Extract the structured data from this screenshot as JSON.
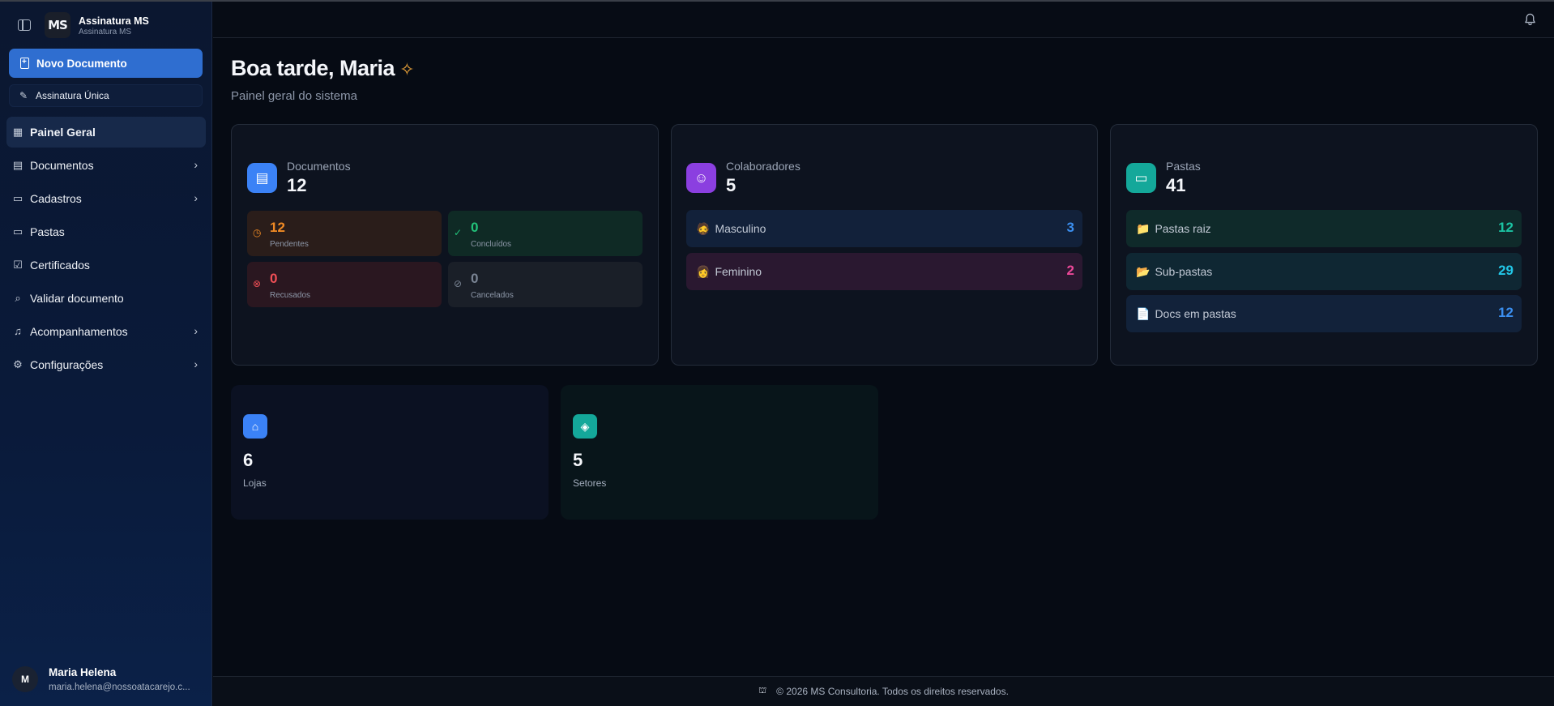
{
  "app": {
    "title": "Assinatura MS",
    "subtitle": "Assinatura MS",
    "logo_text": "MS"
  },
  "sidebar": {
    "new_document_label": "Novo Documento",
    "single_signature_label": "Assinatura Única",
    "items": [
      {
        "label": "Painel Geral",
        "icon": "dashboard-icon",
        "active": true,
        "has_children": false
      },
      {
        "label": "Documentos",
        "icon": "file-icon",
        "active": false,
        "has_children": true
      },
      {
        "label": "Cadastros",
        "icon": "folder-icon",
        "active": false,
        "has_children": true
      },
      {
        "label": "Pastas",
        "icon": "folder-open-icon",
        "active": false,
        "has_children": false
      },
      {
        "label": "Certificados",
        "icon": "certificate-icon",
        "active": false,
        "has_children": false
      },
      {
        "label": "Validar documento",
        "icon": "search-icon",
        "active": false,
        "has_children": false
      },
      {
        "label": "Acompanhamentos",
        "icon": "bell-icon",
        "active": false,
        "has_children": true
      },
      {
        "label": "Configurações",
        "icon": "gear-icon",
        "active": false,
        "has_children": true
      }
    ]
  },
  "user": {
    "initial": "M",
    "name": "Maria Helena",
    "email": "maria.helena@nossoatacarejo.c..."
  },
  "main": {
    "greeting": "Boa tarde, Maria",
    "subtitle": "Painel geral do sistema",
    "documents": {
      "label": "Documentos",
      "value": "12",
      "tiles": {
        "pending": {
          "value": "12",
          "label": "Pendentes"
        },
        "completed": {
          "value": "0",
          "label": "Concluídos"
        },
        "rejected": {
          "value": "0",
          "label": "Recusados"
        },
        "cancelled": {
          "value": "0",
          "label": "Cancelados"
        }
      }
    },
    "collaborators": {
      "label": "Colaboradores",
      "value": "5",
      "rows": {
        "male": {
          "emoji": "🧔",
          "label": "Masculino",
          "value": "3"
        },
        "female": {
          "emoji": "👩",
          "label": "Feminino",
          "value": "2"
        }
      }
    },
    "folders": {
      "label": "Pastas",
      "value": "41",
      "rows": {
        "root": {
          "emoji": "📁",
          "label": "Pastas raiz",
          "value": "12"
        },
        "sub": {
          "emoji": "📂",
          "label": "Sub-pastas",
          "value": "29"
        },
        "docs": {
          "emoji": "📄",
          "label": "Docs em pastas",
          "value": "12"
        }
      }
    },
    "stores": {
      "value": "6",
      "label": "Lojas"
    },
    "sectors": {
      "value": "5",
      "label": "Setores"
    }
  },
  "footer": {
    "text": "© 2026 MS Consultoria. Todos os direitos reservados."
  },
  "colors": {
    "accent_blue": "#2f6ed0",
    "orange": "#f08a24",
    "green": "#22c27a",
    "red": "#ef4f56",
    "pink": "#ec4899",
    "teal": "#1bc3a3",
    "cyan": "#22c7e8",
    "sky": "#3b8ff0"
  }
}
